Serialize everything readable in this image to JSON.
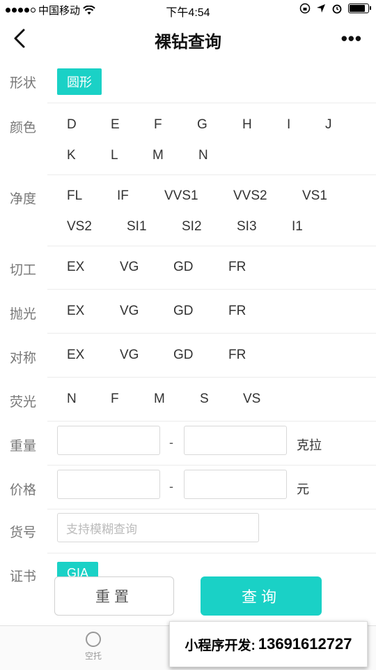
{
  "status": {
    "carrier": "中国移动",
    "time": "下午4:54"
  },
  "nav": {
    "title": "裸钻查询",
    "more": "•••"
  },
  "shape": {
    "label": "形状",
    "selected": "圆形"
  },
  "color": {
    "label": "颜色",
    "options": [
      "D",
      "E",
      "F",
      "G",
      "H",
      "I",
      "J",
      "K",
      "L",
      "M",
      "N"
    ]
  },
  "clarity": {
    "label": "净度",
    "options": [
      "FL",
      "IF",
      "VVS1",
      "VVS2",
      "VS1",
      "VS2",
      "SI1",
      "SI2",
      "SI3",
      "I1"
    ]
  },
  "cut": {
    "label": "切工",
    "options": [
      "EX",
      "VG",
      "GD",
      "FR"
    ]
  },
  "polish": {
    "label": "抛光",
    "options": [
      "EX",
      "VG",
      "GD",
      "FR"
    ]
  },
  "symmetry": {
    "label": "对称",
    "options": [
      "EX",
      "VG",
      "GD",
      "FR"
    ]
  },
  "fluorescence": {
    "label": "荧光",
    "options": [
      "N",
      "F",
      "M",
      "S",
      "VS"
    ]
  },
  "weight": {
    "label": "重量",
    "separator": "-",
    "unit": "克拉",
    "min_value": "",
    "max_value": ""
  },
  "price": {
    "label": "价格",
    "separator": "-",
    "unit": "元",
    "min_value": "",
    "max_value": ""
  },
  "sku": {
    "label": "货号",
    "placeholder": "支持模糊查询"
  },
  "certificate": {
    "label": "证书",
    "selected": "GIA"
  },
  "buttons": {
    "reset": "重置",
    "query": "查询"
  },
  "tabs": {
    "tab1_label": "空托"
  },
  "banner": {
    "text1": "小程序开发:",
    "text2": "13691612727"
  },
  "colors": {
    "accent": "#1ad1c6"
  }
}
